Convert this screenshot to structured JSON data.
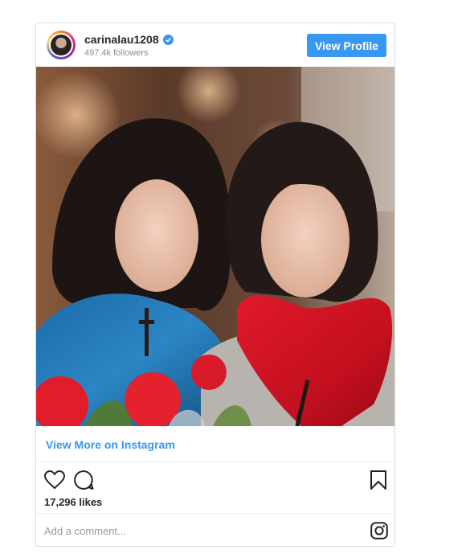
{
  "header": {
    "username": "carinalau1208",
    "followers": "497.4k followers",
    "view_profile_label": "View Profile"
  },
  "post": {
    "view_more_label": "View More on Instagram",
    "likes": "17,296 likes",
    "comment_placeholder": "Add a comment..."
  },
  "icons": {
    "verified": "verified-badge-icon",
    "like": "heart-icon",
    "comment": "speech-bubble-icon",
    "save": "bookmark-icon",
    "instagram": "instagram-logo-icon"
  },
  "colors": {
    "accent": "#3897f0",
    "text": "#262626",
    "muted": "#8e8e8e",
    "border": "#dbdbdb"
  }
}
